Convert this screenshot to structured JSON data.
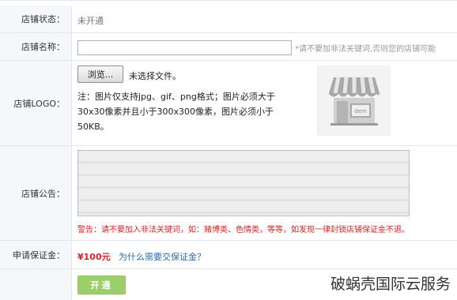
{
  "form": {
    "status": {
      "label": "店铺状态：",
      "value": "未开通"
    },
    "name": {
      "label": "店铺名称：",
      "value": "",
      "hint": "*请不要加非法关键词,否则您的店铺可能"
    },
    "logo": {
      "label": "店铺LOGO：",
      "browse_label": "浏览...",
      "file_status": "未选择文件。",
      "note_lines": [
        "注：图片仅支持jpg、gif、png格式；图片必须大于",
        "30x30像素并且小于300x300像素，图片必须小于",
        "50KB。"
      ],
      "preview_icon": "storefront-icon",
      "preview_sign": "dem"
    },
    "notice": {
      "label": "店铺公告：",
      "value": "",
      "warning": "警告：请不要加入非法关键词，如：赌博类、色情类，等等，如发现一律封锁店铺保证金不退。"
    },
    "deposit": {
      "label": "申请保证金：",
      "amount": "¥100元",
      "link": "为什么需要交保证金？"
    },
    "submit": {
      "label": "开通"
    }
  },
  "watermark": "破蜗壳国际云服务",
  "colors": {
    "label_bg": "#f5f7fa",
    "border": "#e3e7ee",
    "warning": "#e02020",
    "link": "#2b6cb8",
    "submit_bg": "#9ccf6a"
  }
}
